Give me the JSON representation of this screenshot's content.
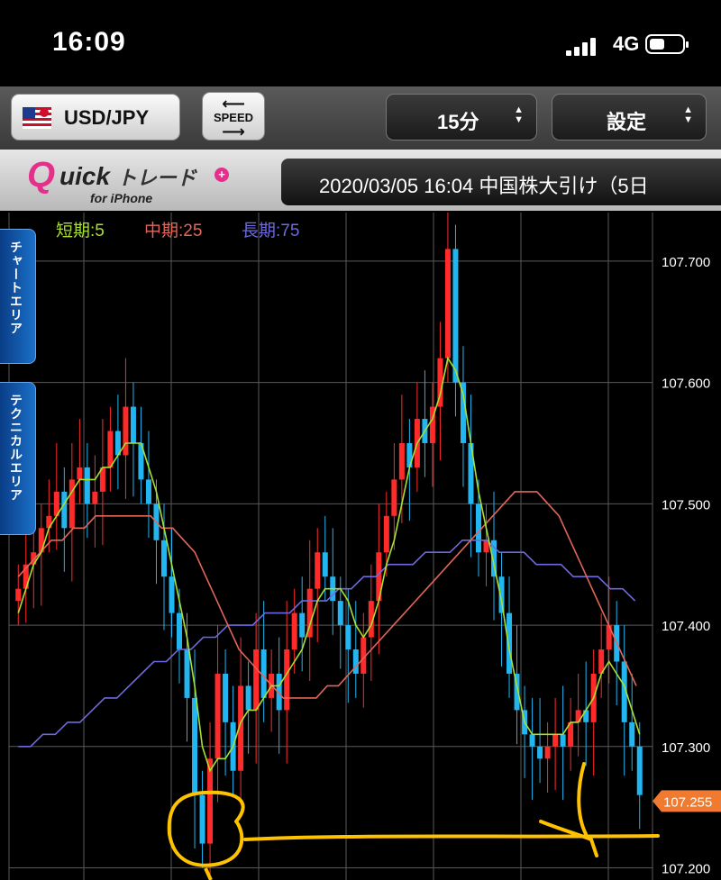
{
  "status_bar": {
    "time": "16:09",
    "network": "4G"
  },
  "toolbar": {
    "pair_label": "USD/JPY",
    "speed_label": "SPEED",
    "interval_label": "15分",
    "settings_label": "設定"
  },
  "brand": {
    "logo_main": "uick",
    "logo_q": "Q",
    "logo_kana": "トレード",
    "logo_sub": "for iPhone",
    "ticker_text": "2020/03/05 16:04 中国株大引け（5日"
  },
  "side_tabs": {
    "chart_area": "チャートエリア",
    "technical_area": "テクニカルエリア"
  },
  "legend": {
    "short": "短期:5",
    "mid": "中期:25",
    "long": "長期:75"
  },
  "price_axis": {
    "labels": [
      "107.700",
      "107.600",
      "107.500",
      "107.400",
      "107.300",
      "107.200"
    ],
    "current_price": "107.255"
  },
  "colors": {
    "up": "#ff2a2a",
    "down": "#22b5f0",
    "ma_short": "#a8e030",
    "ma_mid": "#e0675a",
    "ma_long": "#6d6ae0",
    "current_marker": "#f07a30",
    "annotation": "#ffc200"
  },
  "chart_data": {
    "type": "candlestick",
    "ylim": [
      107.19,
      107.74
    ],
    "y_ticks": [
      107.7,
      107.6,
      107.5,
      107.4,
      107.3,
      107.2
    ],
    "close": [
      107.43,
      107.45,
      107.46,
      107.48,
      107.49,
      107.51,
      107.48,
      107.52,
      107.53,
      107.5,
      107.51,
      107.53,
      107.56,
      107.54,
      107.58,
      107.55,
      107.52,
      107.5,
      107.47,
      107.44,
      107.41,
      107.38,
      107.34,
      107.26,
      107.22,
      107.29,
      107.36,
      107.32,
      107.28,
      107.35,
      107.33,
      107.38,
      107.34,
      107.36,
      107.33,
      107.38,
      107.41,
      107.39,
      107.43,
      107.46,
      107.44,
      107.42,
      107.4,
      107.38,
      107.36,
      107.39,
      107.42,
      107.46,
      107.49,
      107.52,
      107.55,
      107.53,
      107.57,
      107.55,
      107.58,
      107.62,
      107.71,
      107.6,
      107.55,
      107.5,
      107.46,
      107.47,
      107.44,
      107.41,
      107.36,
      107.33,
      107.31,
      107.3,
      107.29,
      107.3,
      107.31,
      107.3,
      107.32,
      107.33,
      107.32,
      107.36,
      107.38,
      107.4,
      107.37,
      107.32,
      107.3,
      107.26
    ],
    "ma_short": [
      107.41,
      107.43,
      107.45,
      107.46,
      107.48,
      107.49,
      107.5,
      107.51,
      107.52,
      107.52,
      107.52,
      107.53,
      107.53,
      107.54,
      107.55,
      107.55,
      107.55,
      107.53,
      107.51,
      107.48,
      107.45,
      107.42,
      107.39,
      107.35,
      107.3,
      107.28,
      107.29,
      107.29,
      107.3,
      107.32,
      107.33,
      107.33,
      107.34,
      107.35,
      107.35,
      107.36,
      107.37,
      107.38,
      107.4,
      107.42,
      107.43,
      107.43,
      107.43,
      107.42,
      107.4,
      107.39,
      107.4,
      107.42,
      107.45,
      107.47,
      107.5,
      107.53,
      107.55,
      107.56,
      107.57,
      107.59,
      107.62,
      107.61,
      107.59,
      107.55,
      107.51,
      107.48,
      107.45,
      107.42,
      107.38,
      107.35,
      107.32,
      107.31,
      107.31,
      107.31,
      107.31,
      107.31,
      107.32,
      107.32,
      107.33,
      107.34,
      107.36,
      107.37,
      107.36,
      107.35,
      107.33,
      107.31
    ],
    "ma_mid": [
      107.44,
      107.45,
      107.46,
      107.47,
      107.47,
      107.48,
      107.48,
      107.49,
      107.49,
      107.49,
      107.49,
      107.49,
      107.49,
      107.48,
      107.48,
      107.47,
      107.46,
      107.44,
      107.42,
      107.4,
      107.38,
      107.37,
      107.36,
      107.35,
      107.34,
      107.34,
      107.34,
      107.34,
      107.35,
      107.35,
      107.36,
      107.37,
      107.38,
      107.39,
      107.4,
      107.41,
      107.42,
      107.43,
      107.44,
      107.45,
      107.46,
      107.47,
      107.48,
      107.49,
      107.5,
      107.51,
      107.51,
      107.51,
      107.5,
      107.49,
      107.47,
      107.45,
      107.43,
      107.41,
      107.39,
      107.37,
      107.35
    ],
    "ma_long": [
      107.3,
      107.3,
      107.31,
      107.31,
      107.32,
      107.32,
      107.33,
      107.34,
      107.34,
      107.35,
      107.36,
      107.37,
      107.37,
      107.38,
      107.38,
      107.39,
      107.39,
      107.4,
      107.4,
      107.4,
      107.41,
      107.41,
      107.41,
      107.42,
      107.42,
      107.42,
      107.43,
      107.43,
      107.44,
      107.44,
      107.45,
      107.45,
      107.45,
      107.46,
      107.46,
      107.46,
      107.47,
      107.47,
      107.47,
      107.46,
      107.46,
      107.46,
      107.45,
      107.45,
      107.45,
      107.44,
      107.44,
      107.44,
      107.43,
      107.43,
      107.42
    ]
  }
}
